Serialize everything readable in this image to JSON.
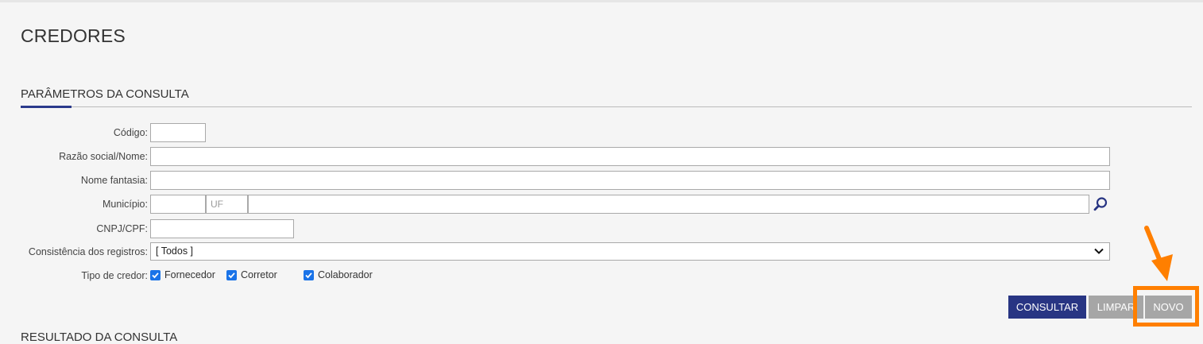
{
  "page": {
    "title": "CREDORES"
  },
  "params": {
    "section_title": "PARÂMETROS DA CONSULTA",
    "codigo_label": "Código:",
    "razao_label": "Razão social/Nome:",
    "fantasia_label": "Nome fantasia:",
    "municipio_label": "Município:",
    "uf_placeholder": "UF",
    "cnpj_label": "CNPJ/CPF:",
    "consistencia_label": "Consistência dos registros:",
    "consistencia_value": "[ Todos ]",
    "tipo_label": "Tipo de credor:",
    "tipos": [
      {
        "label": "Fornecedor",
        "checked": true
      },
      {
        "label": "Corretor",
        "checked": true
      },
      {
        "label": "Colaborador",
        "checked": true
      }
    ]
  },
  "actions": {
    "consultar": "CONSULTAR",
    "limpar": "LIMPAR",
    "novo": "NOVO"
  },
  "results": {
    "section_title": "RESULTADO DA CONSULTA"
  },
  "colors": {
    "primary": "#283583",
    "highlight": "#ff7f00",
    "checkbox": "#1a73e8",
    "disabled": "#a6a6a6"
  }
}
